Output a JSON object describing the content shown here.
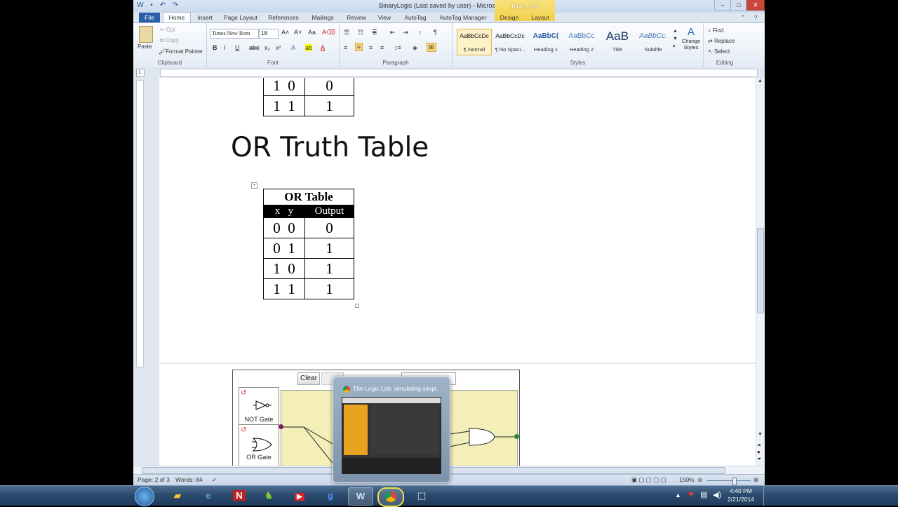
{
  "window": {
    "title": "BinaryLogic (Last saved by user) - Microsoft Word",
    "context_tab_group": "Table Tools",
    "controls": [
      "–",
      "□",
      "✕"
    ]
  },
  "tabs": {
    "file": "File",
    "items": [
      "Home",
      "Insert",
      "Page Layout",
      "References",
      "Mailings",
      "Review",
      "View",
      "AutoTag",
      "AutoTag Manager",
      "Design",
      "Layout"
    ]
  },
  "ribbon": {
    "clipboard": {
      "label": "Clipboard",
      "paste": "Paste",
      "cut": "Cut",
      "copy": "Copy",
      "format_painter": "Format Painter"
    },
    "font": {
      "label": "Font",
      "font_name": "Times New Rom",
      "font_size": "18"
    },
    "paragraph": {
      "label": "Paragraph"
    },
    "styles": {
      "label": "Styles",
      "items": [
        {
          "preview": "AaBbCcDc",
          "name": "¶ Normal"
        },
        {
          "preview": "AaBbCcDc",
          "name": "¶ No Spaci..."
        },
        {
          "preview": "AaBbC(",
          "name": "Heading 1"
        },
        {
          "preview": "AaBbCc",
          "name": "Heading 2"
        },
        {
          "preview": "AaB",
          "name": "Title"
        },
        {
          "preview": "AaBbCc.",
          "name": "Subtitle"
        }
      ],
      "change_styles": "Change Styles"
    },
    "editing": {
      "label": "Editing",
      "find": "Find",
      "replace": "Replace",
      "select": "Select"
    }
  },
  "document": {
    "prev_table_rows": [
      {
        "x": "1",
        "y": "0",
        "out": "0"
      },
      {
        "x": "1",
        "y": "1",
        "out": "1"
      }
    ],
    "heading": "OR Truth Table",
    "or_table": {
      "title": "OR Table",
      "headers": {
        "x": "x",
        "y": "y",
        "out": "Output"
      },
      "rows": [
        {
          "x": "0",
          "y": "0",
          "out": "0"
        },
        {
          "x": "0",
          "y": "1",
          "out": "1"
        },
        {
          "x": "1",
          "y": "0",
          "out": "1"
        },
        {
          "x": "1",
          "y": "1",
          "out": "1"
        }
      ]
    },
    "logic_lab": {
      "clear_button": "Clear",
      "not_gate": "NOT Gate",
      "or_gate": "OR Gate"
    }
  },
  "status": {
    "page": "Page: 2 of 3",
    "words": "Words: 84",
    "zoom": "150%"
  },
  "taskbar": {
    "thumbnail_title": "The Logic Lab: simulating simpl...",
    "clock_time": "4:40 PM",
    "clock_date": "2/21/2014"
  }
}
